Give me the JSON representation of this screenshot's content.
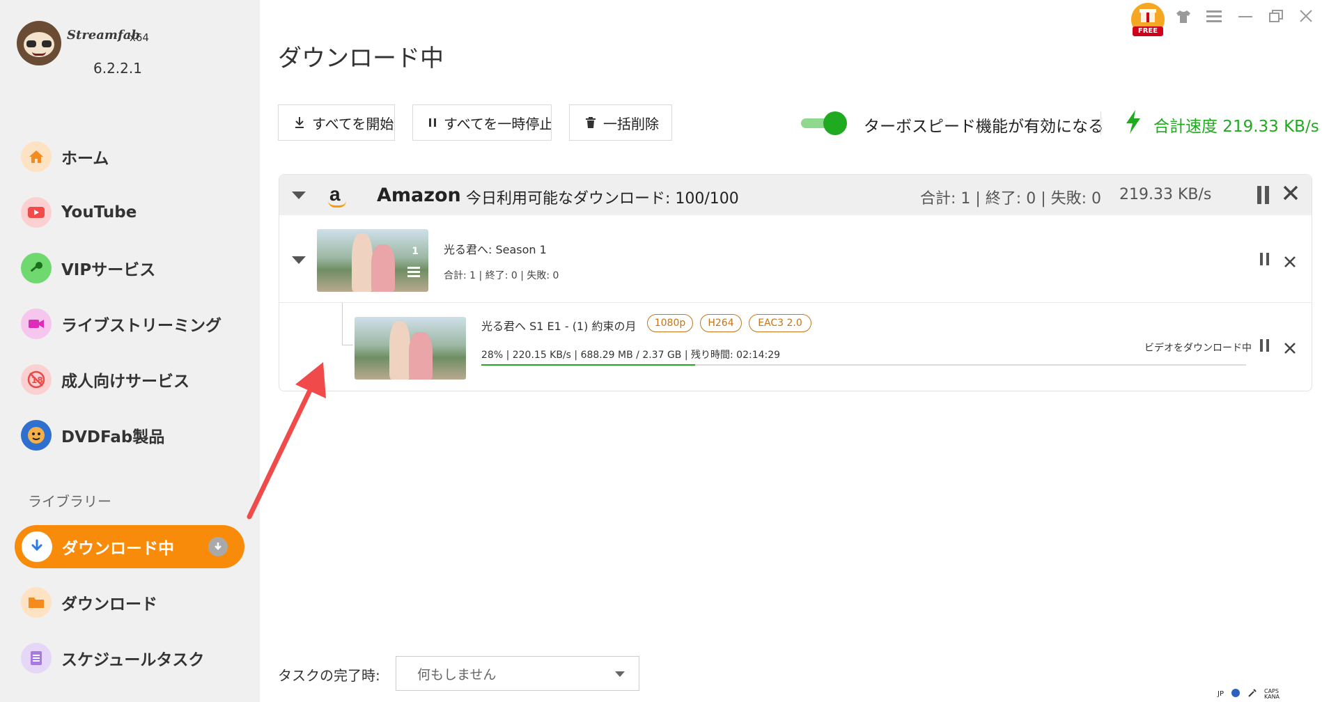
{
  "app": {
    "brand": "Streamfab",
    "arch": "x64",
    "version": "6.2.2.1"
  },
  "sidebar": {
    "items": [
      {
        "label": "ホーム",
        "icon": "home-icon",
        "color": "#f5a04a"
      },
      {
        "label": "YouTube",
        "icon": "youtube-icon",
        "color": "#f04a4a"
      },
      {
        "label": "VIPサービス",
        "icon": "key-icon",
        "color": "#4cc94c"
      },
      {
        "label": "ライブストリーミング",
        "icon": "video-camera-icon",
        "color": "#e84ac9"
      },
      {
        "label": "成人向けサービス",
        "icon": "no-18-icon",
        "color": "#e84a4a"
      },
      {
        "label": "DVDFab製品",
        "icon": "dvdfab-icon",
        "color": "#3a7bd5"
      }
    ],
    "library_title": "ライブラリー",
    "library": [
      {
        "label": "ダウンロード中",
        "icon": "download-icon",
        "active": true
      },
      {
        "label": "ダウンロード",
        "icon": "folder-icon",
        "color": "#f5a04a"
      },
      {
        "label": "スケジュールタスク",
        "icon": "schedule-list-icon",
        "color": "#a87ae0"
      }
    ]
  },
  "main": {
    "title": "ダウンロード中",
    "toolbar": {
      "start_all": "すべてを開始",
      "pause_all": "すべてを一時停止",
      "delete_all": "一括削除"
    },
    "turbo_label": "ターボスピード機能が有効になる",
    "total_speed": "合計速度 219.33 KB/s",
    "accent": "#1faa1f",
    "active_color": "#f98b0b"
  },
  "group": {
    "service": "Amazon",
    "quota": "今日利用可能なダウンロード: 100/100",
    "stats": "合計: 1 | 終了: 0 | 失敗: 0",
    "speed": "219.33 KB/s",
    "season": {
      "title": "光る君へ: Season 1",
      "stats": "合計: 1 | 終了: 0 | 失敗: 0",
      "count": "1"
    },
    "episode": {
      "title": "光る君へ S1 E1 - (1) 約束の月",
      "tags": [
        "1080p",
        "H264",
        "EAC3 2.0"
      ],
      "progress_text": "28% | 220.15 KB/s | 688.29 MB / 2.37 GB | 残り時間: 02:14:29",
      "progress": 0.28,
      "status": "ビデオをダウンロード中"
    }
  },
  "footer": {
    "finish_label": "タスクの完了時:",
    "finish_value": "何もしません"
  },
  "titlebar": {
    "free_label": "FREE"
  },
  "tray": {
    "ime": "JP",
    "caps": "CAPS",
    "kana": "KANA"
  }
}
